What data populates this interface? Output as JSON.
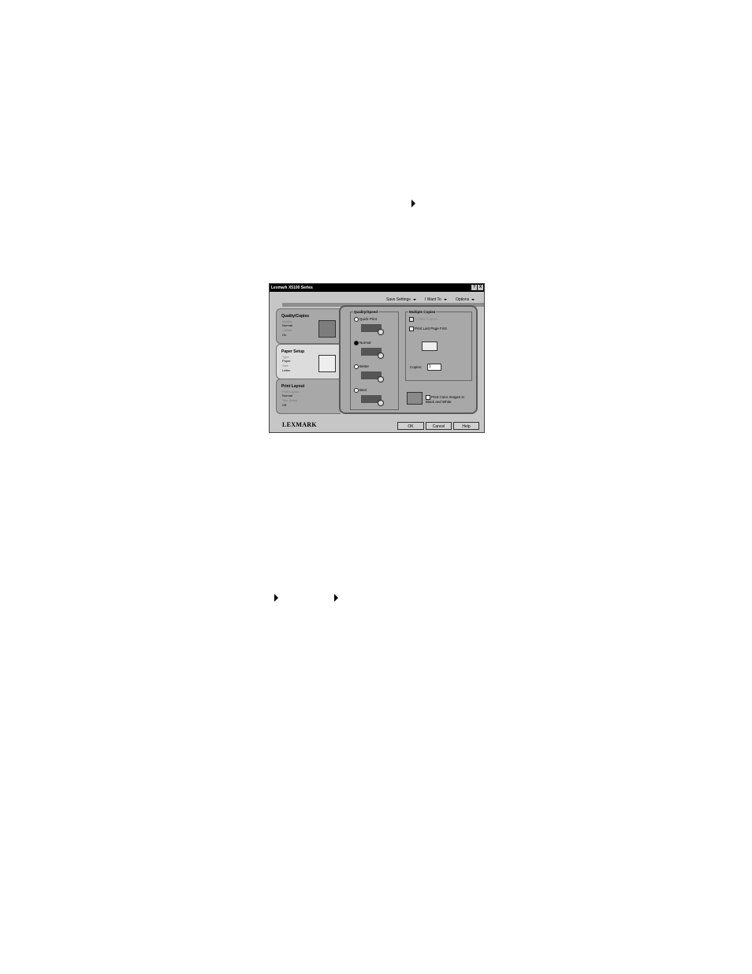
{
  "dialog": {
    "title": "Lexmark X5100 Series",
    "help_btn": "?",
    "close_btn": "X"
  },
  "menus": [
    "Save Settings",
    "I Want To",
    "Options"
  ],
  "tabs": [
    {
      "title": "Quality/Copies",
      "lines": [
        "Quality",
        "Normal",
        "Collate",
        "On"
      ]
    },
    {
      "title": "Paper Setup",
      "lines": [
        "Type",
        "Paper",
        "Size",
        "Letter"
      ]
    },
    {
      "title": "Print Layout",
      "lines": [
        "Print Layout",
        "Normal",
        "Two-Sided",
        "Off"
      ]
    }
  ],
  "quality": {
    "label": "Quality/Speed",
    "options": [
      {
        "label": "Quick Print",
        "selected": false
      },
      {
        "label": "Normal",
        "selected": true
      },
      {
        "label": "Better",
        "selected": false
      },
      {
        "label": "Best",
        "selected": false
      }
    ]
  },
  "copies": {
    "label": "Multiple Copies",
    "collate_label": "Collate Copies",
    "last_page_label": "Print Last Page First",
    "copies_label": "Copies:",
    "copies_value": "1"
  },
  "color_bw_label": "Print Color Images in Black and White",
  "logo": "LEXMARK",
  "buttons": {
    "ok": "OK",
    "cancel": "Cancel",
    "help": "Help"
  }
}
